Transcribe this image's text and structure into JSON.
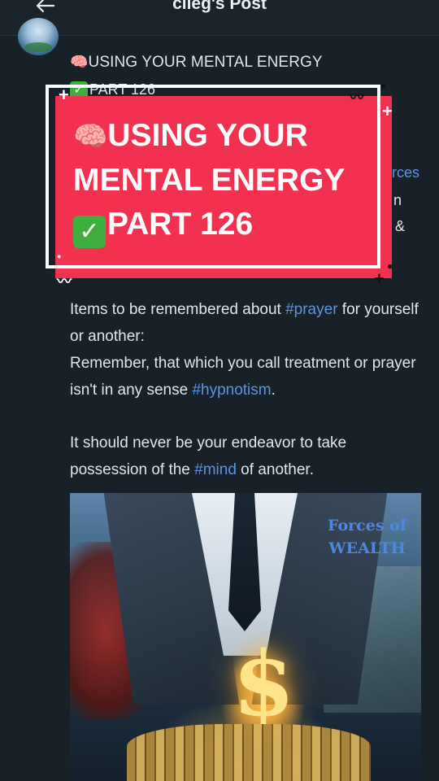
{
  "header": {
    "title": "cileg's Post",
    "back_icon": "arrow-left-icon"
  },
  "post": {
    "title_emoji": "🧠",
    "title_text": "USING YOUR MENTAL ENERGY",
    "part_check": "✓",
    "part_text": "PART 126",
    "peek_right_1": "rces",
    "peek_right_2": "n",
    "peek_right_3": "&",
    "para1_a": "Items to be remembered about ",
    "para1_tag": "#prayer",
    "para1_b": " for yourself or another:",
    "para2_a": "Remember, that which you call treatment or prayer isn't in any sense ",
    "para2_tag": "#hypnotism",
    "para2_b": ".",
    "para3_a": "It should never be your endeavor to take possession of the ",
    "para3_tag": "#mind",
    "para3_b": " of another.",
    "image_caption_1": "Forces of",
    "image_caption_2": "WEALTH",
    "image_symbol": "$"
  },
  "overlay": {
    "line1_emoji": "🧠",
    "line1_text": "USING YOUR",
    "line2_text": "MENTAL ENERGY",
    "line3_check": "✓",
    "line3_text": "PART 126",
    "card_color": "#f2304f"
  },
  "colors": {
    "background": "#182028",
    "hashtag": "#5b94e3",
    "text": "#e2e6ea"
  }
}
